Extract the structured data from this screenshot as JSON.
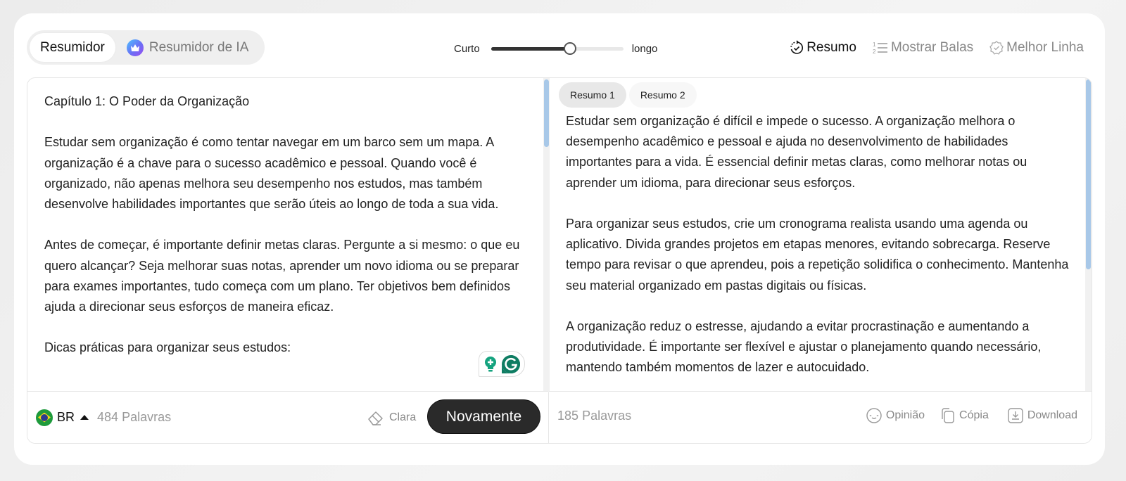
{
  "top_bar": {
    "mode_tabs": [
      {
        "label": "Resumidor",
        "active": true
      },
      {
        "label": "Resumidor de IA",
        "active": false,
        "icon": "crown-icon"
      }
    ],
    "length": {
      "min_label": "Curto",
      "max_label": "longo",
      "value_fraction": 0.6
    },
    "actions": [
      {
        "label": "Resumo",
        "icon": "timer-check-icon",
        "active": true
      },
      {
        "label": "Mostrar Balas",
        "icon": "numbered-list-icon",
        "active": false
      },
      {
        "label": "Melhor Linha",
        "icon": "badge-check-icon",
        "active": false
      }
    ]
  },
  "input_panel": {
    "paragraphs": [
      "Capítulo 1: O Poder da Organização",
      "Estudar sem organização é como tentar navegar em um barco sem um mapa. A organização é a chave para o sucesso acadêmico e pessoal. Quando você é organizado, não apenas melhora seu desempenho nos estudos, mas também desenvolve habilidades importantes que serão úteis ao longo de toda a sua vida.",
      "Antes de começar, é importante definir metas claras. Pergunte a si mesmo: o que eu quero alcançar? Seja melhorar suas notas, aprender um novo idioma ou se preparar para exames importantes, tudo começa com um plano. Ter objetivos bem definidos ajuda a direcionar seus esforços de maneira eficaz.",
      "Dicas práticas para organizar seus estudos:"
    ],
    "scroll_position_fraction": 0.0,
    "footer": {
      "language": "BR",
      "word_count": "484",
      "word_label": "Palavras",
      "clear_label": "Clara",
      "again_label": "Novamente"
    }
  },
  "output_panel": {
    "tabs": [
      {
        "label": "Resumo 1",
        "active": true
      },
      {
        "label": "Resumo 2",
        "active": false
      }
    ],
    "paragraphs": [
      "Estudar sem organização é difícil e impede o sucesso. A organização melhora o desempenho acadêmico e pessoal e ajuda no desenvolvimento de habilidades importantes para a vida. É essencial definir metas claras, como melhorar notas ou aprender um idioma, para direcionar seus esforços.",
      "Para organizar seus estudos, crie um cronograma realista usando uma agenda ou aplicativo. Divida grandes projetos em etapas menores, evitando sobrecarga. Reserve tempo para revisar o que aprendeu, pois a repetição solidifica o conhecimento. Mantenha seu material organizado em pastas digitais ou físicas.",
      "A organização reduz o estresse, ajudando a evitar procrastinação e aumentando a produtividade. É importante ser flexível e ajustar o planejamento quando necessário, mantendo também momentos de lazer e autocuidado."
    ],
    "footer": {
      "word_count": "185",
      "word_label": "Palavras",
      "actions": [
        {
          "label": "Opinião",
          "icon": "smiley-icon"
        },
        {
          "label": "Cópia",
          "icon": "copy-icon"
        },
        {
          "label": "Download",
          "icon": "download-icon"
        }
      ]
    }
  },
  "colors": {
    "primary_button": "#2a2a2a",
    "scroll_thumb": "#a8c8e8",
    "grammarly_green": "#15a37f"
  }
}
